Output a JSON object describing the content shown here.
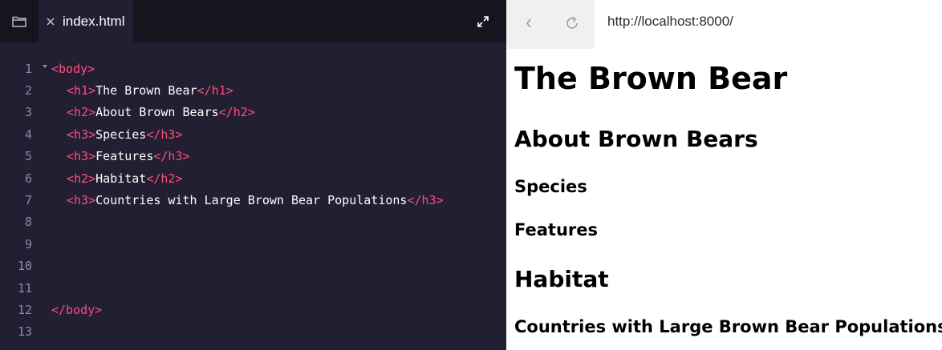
{
  "editor": {
    "tab_label": "index.html",
    "lines": [
      {
        "num": "1",
        "fold": true,
        "parts": [
          {
            "t": "tag",
            "v": "<body>"
          }
        ],
        "indent": 0
      },
      {
        "num": "2",
        "fold": false,
        "parts": [
          {
            "t": "tag",
            "v": "<h1>"
          },
          {
            "t": "txt",
            "v": "The Brown Bear"
          },
          {
            "t": "tag",
            "v": "</h1>"
          }
        ],
        "indent": 1
      },
      {
        "num": "3",
        "fold": false,
        "parts": [
          {
            "t": "tag",
            "v": "<h2>"
          },
          {
            "t": "txt",
            "v": "About Brown Bears"
          },
          {
            "t": "tag",
            "v": "</h2>"
          }
        ],
        "indent": 1
      },
      {
        "num": "4",
        "fold": false,
        "parts": [
          {
            "t": "tag",
            "v": "<h3>"
          },
          {
            "t": "txt",
            "v": "Species"
          },
          {
            "t": "tag",
            "v": "</h3>"
          }
        ],
        "indent": 1
      },
      {
        "num": "5",
        "fold": false,
        "parts": [
          {
            "t": "tag",
            "v": "<h3>"
          },
          {
            "t": "txt",
            "v": "Features"
          },
          {
            "t": "tag",
            "v": "</h3>"
          }
        ],
        "indent": 1
      },
      {
        "num": "6",
        "fold": false,
        "parts": [
          {
            "t": "tag",
            "v": "<h2>"
          },
          {
            "t": "txt",
            "v": "Habitat"
          },
          {
            "t": "tag",
            "v": "</h2>"
          }
        ],
        "indent": 1
      },
      {
        "num": "7",
        "fold": false,
        "parts": [
          {
            "t": "tag",
            "v": "<h3>"
          },
          {
            "t": "txt",
            "v": "Countries with Large Brown Bear Populations"
          },
          {
            "t": "tag",
            "v": "</h3>"
          }
        ],
        "indent": 1
      },
      {
        "num": "8",
        "fold": false,
        "parts": [],
        "indent": 0
      },
      {
        "num": "9",
        "fold": false,
        "parts": [],
        "indent": 0
      },
      {
        "num": "10",
        "fold": false,
        "parts": [],
        "indent": 0
      },
      {
        "num": "11",
        "fold": false,
        "parts": [],
        "indent": 0
      },
      {
        "num": "12",
        "fold": false,
        "parts": [
          {
            "t": "tag",
            "v": "</body>"
          }
        ],
        "indent": 0
      },
      {
        "num": "13",
        "fold": false,
        "parts": [],
        "indent": 0
      }
    ]
  },
  "browser": {
    "url": "http://localhost:8000/",
    "page": {
      "h1": "The Brown Bear",
      "h2_about": "About Brown Bears",
      "h3_species": "Species",
      "h3_features": "Features",
      "h2_habitat": "Habitat",
      "h3_countries": "Countries with Large Brown Bear Populations"
    }
  },
  "colors": {
    "editor_bg": "#211f31",
    "tabbar_bg": "#16141f",
    "tag": "#ff4f7e",
    "line_number": "#8f8aa6",
    "browser_nav_bg": "#f0f0f0"
  },
  "icons": {
    "folder": "folder-icon",
    "close": "close-icon",
    "expand": "expand-icon",
    "back": "chevron-left-icon",
    "reload": "reload-icon"
  }
}
